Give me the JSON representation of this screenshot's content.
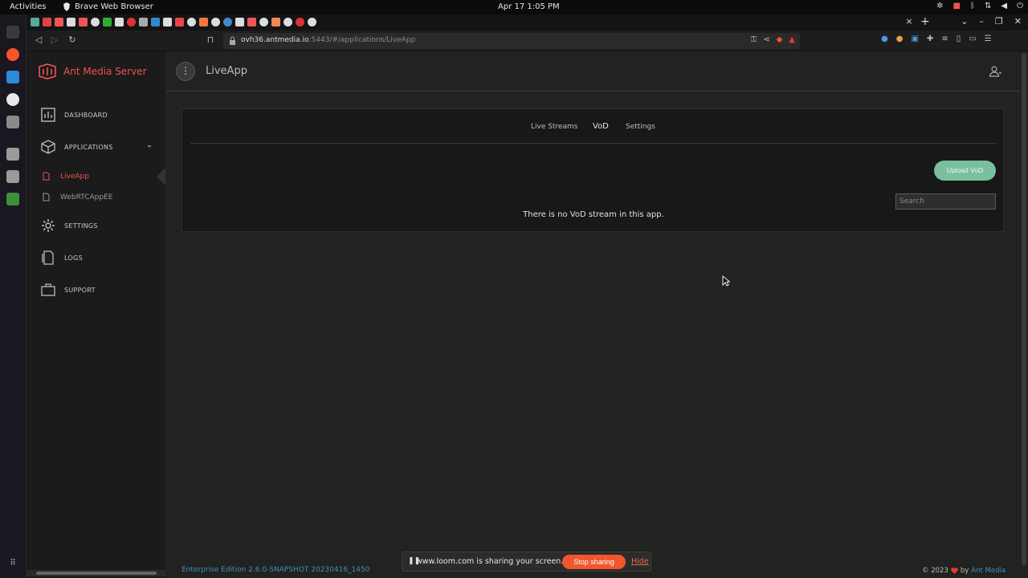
{
  "system": {
    "activities": "Activities",
    "app_name": "Brave Web Browser",
    "clock": "Apr 17  1:05 PM"
  },
  "browser": {
    "url_host": "ovh36.antmedia.io",
    "url_rest": ":5443/#/applications/LiveApp",
    "tab_close": "×",
    "new_tab": "+"
  },
  "sidebar": {
    "brand": "Ant Media Server",
    "items": [
      {
        "label": "DASHBOARD",
        "icon": "dashboard-icon"
      },
      {
        "label": "APPLICATIONS",
        "icon": "cube-icon"
      },
      {
        "label": "SETTINGS",
        "icon": "gear-icon"
      },
      {
        "label": "LOGS",
        "icon": "logs-icon"
      },
      {
        "label": "SUPPORT",
        "icon": "support-icon"
      }
    ],
    "apps": [
      {
        "label": "LiveApp",
        "active": true
      },
      {
        "label": "WebRTCAppEE",
        "active": false
      }
    ]
  },
  "header": {
    "title": "LiveApp",
    "menu_glyph": "⋮"
  },
  "tabs": [
    {
      "label": "Live Streams",
      "active": false
    },
    {
      "label": "VoD",
      "active": true
    },
    {
      "label": "Settings",
      "active": false
    }
  ],
  "vod": {
    "upload_label": "Upload VoD",
    "search_placeholder": "Search",
    "empty_message": "There is no VoD stream in this app."
  },
  "footer": {
    "edition": "Enterprise Edition 2.6.0-SNAPSHOT 20230416_1450",
    "copyright": "© 2023",
    "by": "by",
    "company": "Ant Media"
  },
  "loom": {
    "message": "www.loom.com is sharing your screen.",
    "stop_label": "Stop sharing",
    "hide_label": "Hide"
  },
  "colors": {
    "brand_red": "#ef5350",
    "upload_green": "#7bc09d",
    "link_blue": "#3f8fbf",
    "loom_orange": "#f0572e"
  }
}
